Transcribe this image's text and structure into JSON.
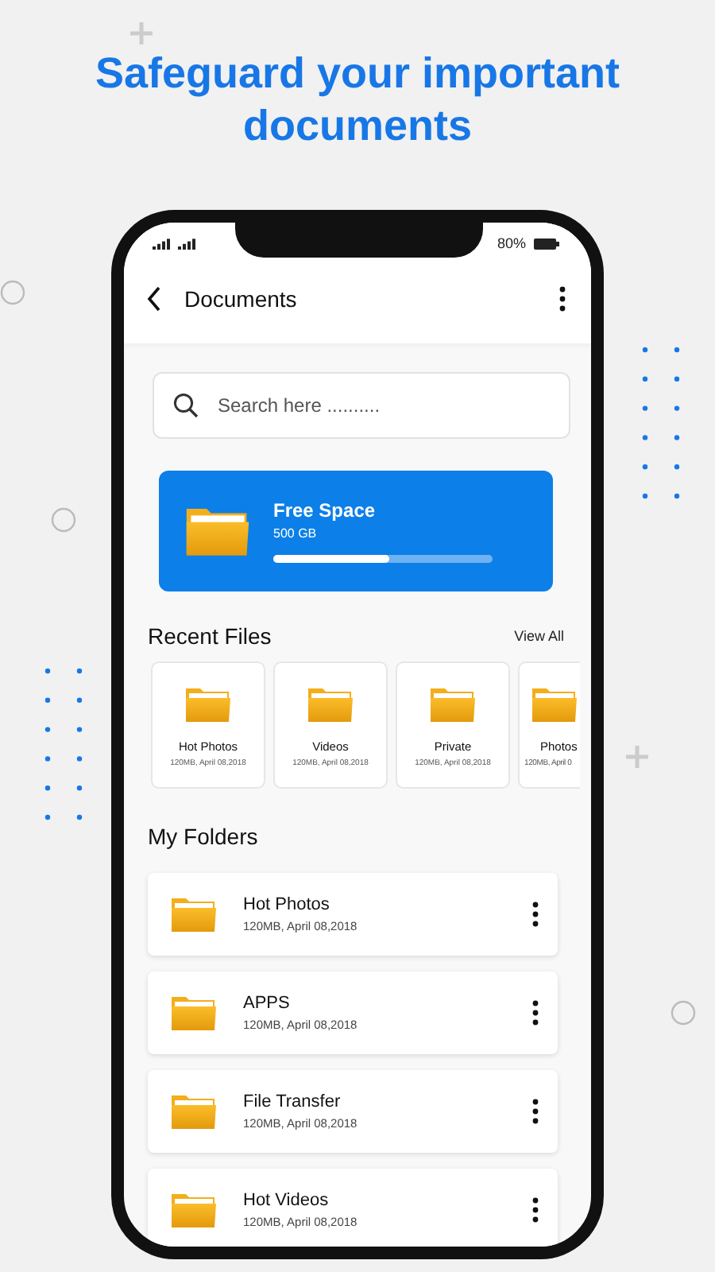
{
  "headline": "Safeguard your important documents",
  "status_bar": {
    "battery": "80%"
  },
  "app_bar": {
    "title": "Documents"
  },
  "search": {
    "placeholder": "Search here .........."
  },
  "storage": {
    "title": "Free Space",
    "size": "500 GB",
    "level": 0.53
  },
  "recent": {
    "title": "Recent Files",
    "action": "View All",
    "items": [
      {
        "name": "Hot Photos",
        "meta": "120MB, April 08,2018",
        "cut": false
      },
      {
        "name": "Videos",
        "meta": "120MB, April 08,2018",
        "cut": false
      },
      {
        "name": "Private",
        "meta": "120MB, April 08,2018",
        "cut": false
      },
      {
        "name": "Photos",
        "meta": "120MB, April 0",
        "cut": true
      }
    ]
  },
  "folders": {
    "title": "My Folders",
    "items": [
      {
        "name": "Hot Photos",
        "meta": "120MB, April 08,2018"
      },
      {
        "name": "APPS",
        "meta": "120MB, April 08,2018"
      },
      {
        "name": "File Transfer",
        "meta": "120MB, April 08,2018"
      },
      {
        "name": "Hot Videos",
        "meta": "120MB, April 08,2018"
      }
    ]
  }
}
